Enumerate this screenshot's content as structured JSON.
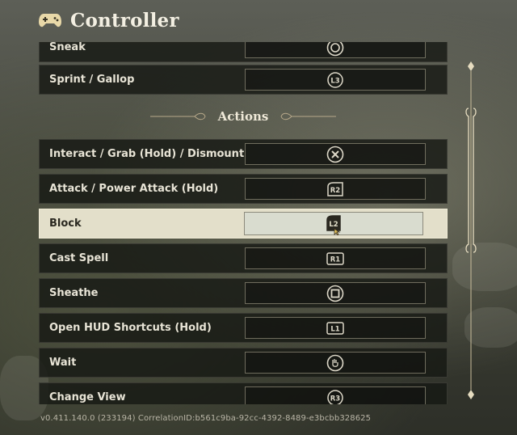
{
  "header": {
    "title": "Controller",
    "icon": "gamepad-icon"
  },
  "section": {
    "title": "Actions"
  },
  "rows_above": [
    {
      "label": "Sneak",
      "binding": "R3 (circle button)",
      "glyph": "stick-press"
    },
    {
      "label": "Sprint / Gallop",
      "binding": "L3",
      "glyph": "L3"
    }
  ],
  "actions": [
    {
      "label": "Interact / Grab (Hold) / Dismount",
      "glyph": "cross"
    },
    {
      "label": "Attack / Power Attack (Hold)",
      "glyph": "R2"
    },
    {
      "label": "Block",
      "glyph": "L2",
      "selected": true
    },
    {
      "label": "Cast Spell",
      "glyph": "R1"
    },
    {
      "label": "Sheathe",
      "glyph": "square"
    },
    {
      "label": "Open HUD Shortcuts (Hold)",
      "glyph": "L1"
    },
    {
      "label": "Wait",
      "glyph": "touchpad"
    },
    {
      "label": "Change View",
      "glyph": "R3"
    }
  ],
  "glyph_text": {
    "L3": "L3",
    "R2": "R2",
    "L2": "L2",
    "R1": "R1",
    "L1": "L1",
    "R3": "R3"
  },
  "footer": {
    "version": "v0.411.140.0 (233194) CorrelationID:b561c9ba-92cc-4392-8489-e3bcbb328625"
  },
  "colors": {
    "accent": "#e3dfca",
    "row_bg": "#16180f",
    "text": "#e8e4d6"
  }
}
